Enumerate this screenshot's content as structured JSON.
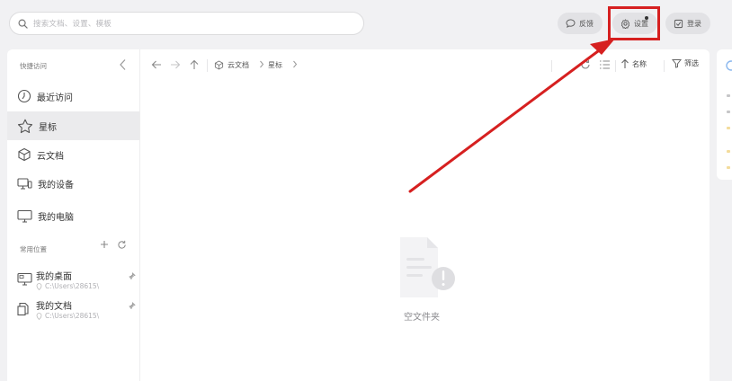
{
  "search": {
    "placeholder": "搜索文档、设置、模板"
  },
  "header_actions": [
    {
      "id": "feedback",
      "label": "反馈",
      "icon": "chat-bubble-icon"
    },
    {
      "id": "settings",
      "label": "设置",
      "icon": "gear-icon",
      "has_notification_dot": true
    },
    {
      "id": "login",
      "label": "登录",
      "icon": "login-icon"
    }
  ],
  "sidebar": {
    "quick_access_title": "快捷访问",
    "items": [
      {
        "label": "最近访问",
        "icon": "clock-icon",
        "active": false
      },
      {
        "label": "星标",
        "icon": "star-icon",
        "active": true
      },
      {
        "label": "云文档",
        "icon": "cloud-doc-icon",
        "active": false
      },
      {
        "label": "我的设备",
        "icon": "devices-icon",
        "active": false
      },
      {
        "label": "我的电脑",
        "icon": "monitor-icon",
        "active": false
      }
    ],
    "common_locations_title": "常用位置",
    "locations": [
      {
        "name": "我的桌面",
        "path": "C:\\Users\\28615\\",
        "icon": "desktop-folder-icon"
      },
      {
        "name": "我的文档",
        "path": "C:\\Users\\28615\\",
        "icon": "documents-folder-icon"
      }
    ]
  },
  "toolbar": {
    "breadcrumb": [
      "云文档",
      "星标"
    ],
    "sort_label": "名称",
    "filter_label": "筛选"
  },
  "empty_state": {
    "text": "空文件夹"
  },
  "colors": {
    "background": "#f1f1f3",
    "panel": "#ffffff",
    "active_item": "#ebebed",
    "annotation_red": "#d62020"
  }
}
